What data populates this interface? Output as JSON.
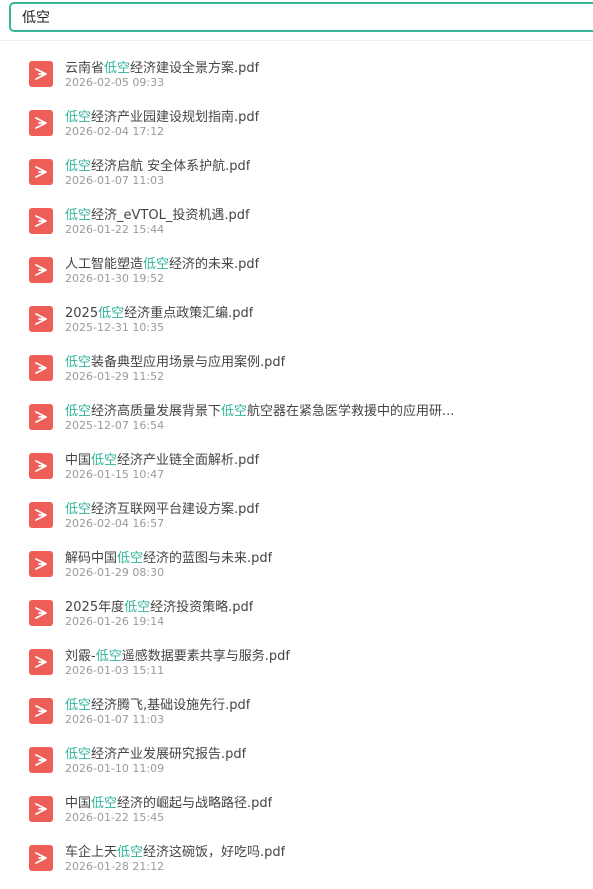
{
  "search": {
    "value": "低空"
  },
  "colors": {
    "accent": "#36b79a",
    "highlight": "#2fb39a",
    "pdf_icon": "#ee5d57"
  },
  "results": [
    {
      "pre": "云南省",
      "hl": "低空",
      "mid": "经济建设全景方案.pdf",
      "hl2": "",
      "post": "",
      "date": "2026-02-05 09:33"
    },
    {
      "pre": "",
      "hl": "低空",
      "mid": "经济产业园建设规划指南.pdf",
      "hl2": "",
      "post": "",
      "date": "2026-02-04 17:12"
    },
    {
      "pre": "",
      "hl": "低空",
      "mid": "经济启航 安全体系护航.pdf",
      "hl2": "",
      "post": "",
      "date": "2026-01-07 11:03"
    },
    {
      "pre": "",
      "hl": "低空",
      "mid": "经济_eVTOL_投资机遇.pdf",
      "hl2": "",
      "post": "",
      "date": "2026-01-22 15:44"
    },
    {
      "pre": "人工智能塑造",
      "hl": "低空",
      "mid": "经济的未来.pdf",
      "hl2": "",
      "post": "",
      "date": "2026-01-30 19:52"
    },
    {
      "pre": "2025",
      "hl": "低空",
      "mid": "经济重点政策汇编.pdf",
      "hl2": "",
      "post": "",
      "date": "2025-12-31 10:35"
    },
    {
      "pre": "",
      "hl": "低空",
      "mid": "装备典型应用场景与应用案例.pdf",
      "hl2": "",
      "post": "",
      "date": "2026-01-29 11:52"
    },
    {
      "pre": "",
      "hl": "低空",
      "mid": "经济高质量发展背景下",
      "hl2": "低空",
      "post": "航空器在紧急医学救援中的应用研...",
      "date": "2025-12-07 16:54"
    },
    {
      "pre": "中国",
      "hl": "低空",
      "mid": "经济产业链全面解析.pdf",
      "hl2": "",
      "post": "",
      "date": "2026-01-15 10:47"
    },
    {
      "pre": "",
      "hl": "低空",
      "mid": "经济互联网平台建设方案.pdf",
      "hl2": "",
      "post": "",
      "date": "2026-02-04 16:57"
    },
    {
      "pre": "解码中国",
      "hl": "低空",
      "mid": "经济的蓝图与未来.pdf",
      "hl2": "",
      "post": "",
      "date": "2026-01-29 08:30"
    },
    {
      "pre": "2025年度",
      "hl": "低空",
      "mid": "经济投资策略.pdf",
      "hl2": "",
      "post": "",
      "date": "2026-01-26 19:14"
    },
    {
      "pre": "刘霰-",
      "hl": "低空",
      "mid": "遥感数据要素共享与服务.pdf",
      "hl2": "",
      "post": "",
      "date": "2026-01-03 15:11"
    },
    {
      "pre": "",
      "hl": "低空",
      "mid": "经济腾飞,基础设施先行.pdf",
      "hl2": "",
      "post": "",
      "date": "2026-01-07 11:03"
    },
    {
      "pre": "",
      "hl": "低空",
      "mid": "经济产业发展研究报告.pdf",
      "hl2": "",
      "post": "",
      "date": "2026-01-10 11:09"
    },
    {
      "pre": "中国",
      "hl": "低空",
      "mid": "经济的崛起与战略路径.pdf",
      "hl2": "",
      "post": "",
      "date": "2026-01-22 15:45"
    },
    {
      "pre": "车企上天",
      "hl": "低空",
      "mid": "经济这碗饭，好吃吗.pdf",
      "hl2": "",
      "post": "",
      "date": "2026-01-28 21:12"
    }
  ]
}
